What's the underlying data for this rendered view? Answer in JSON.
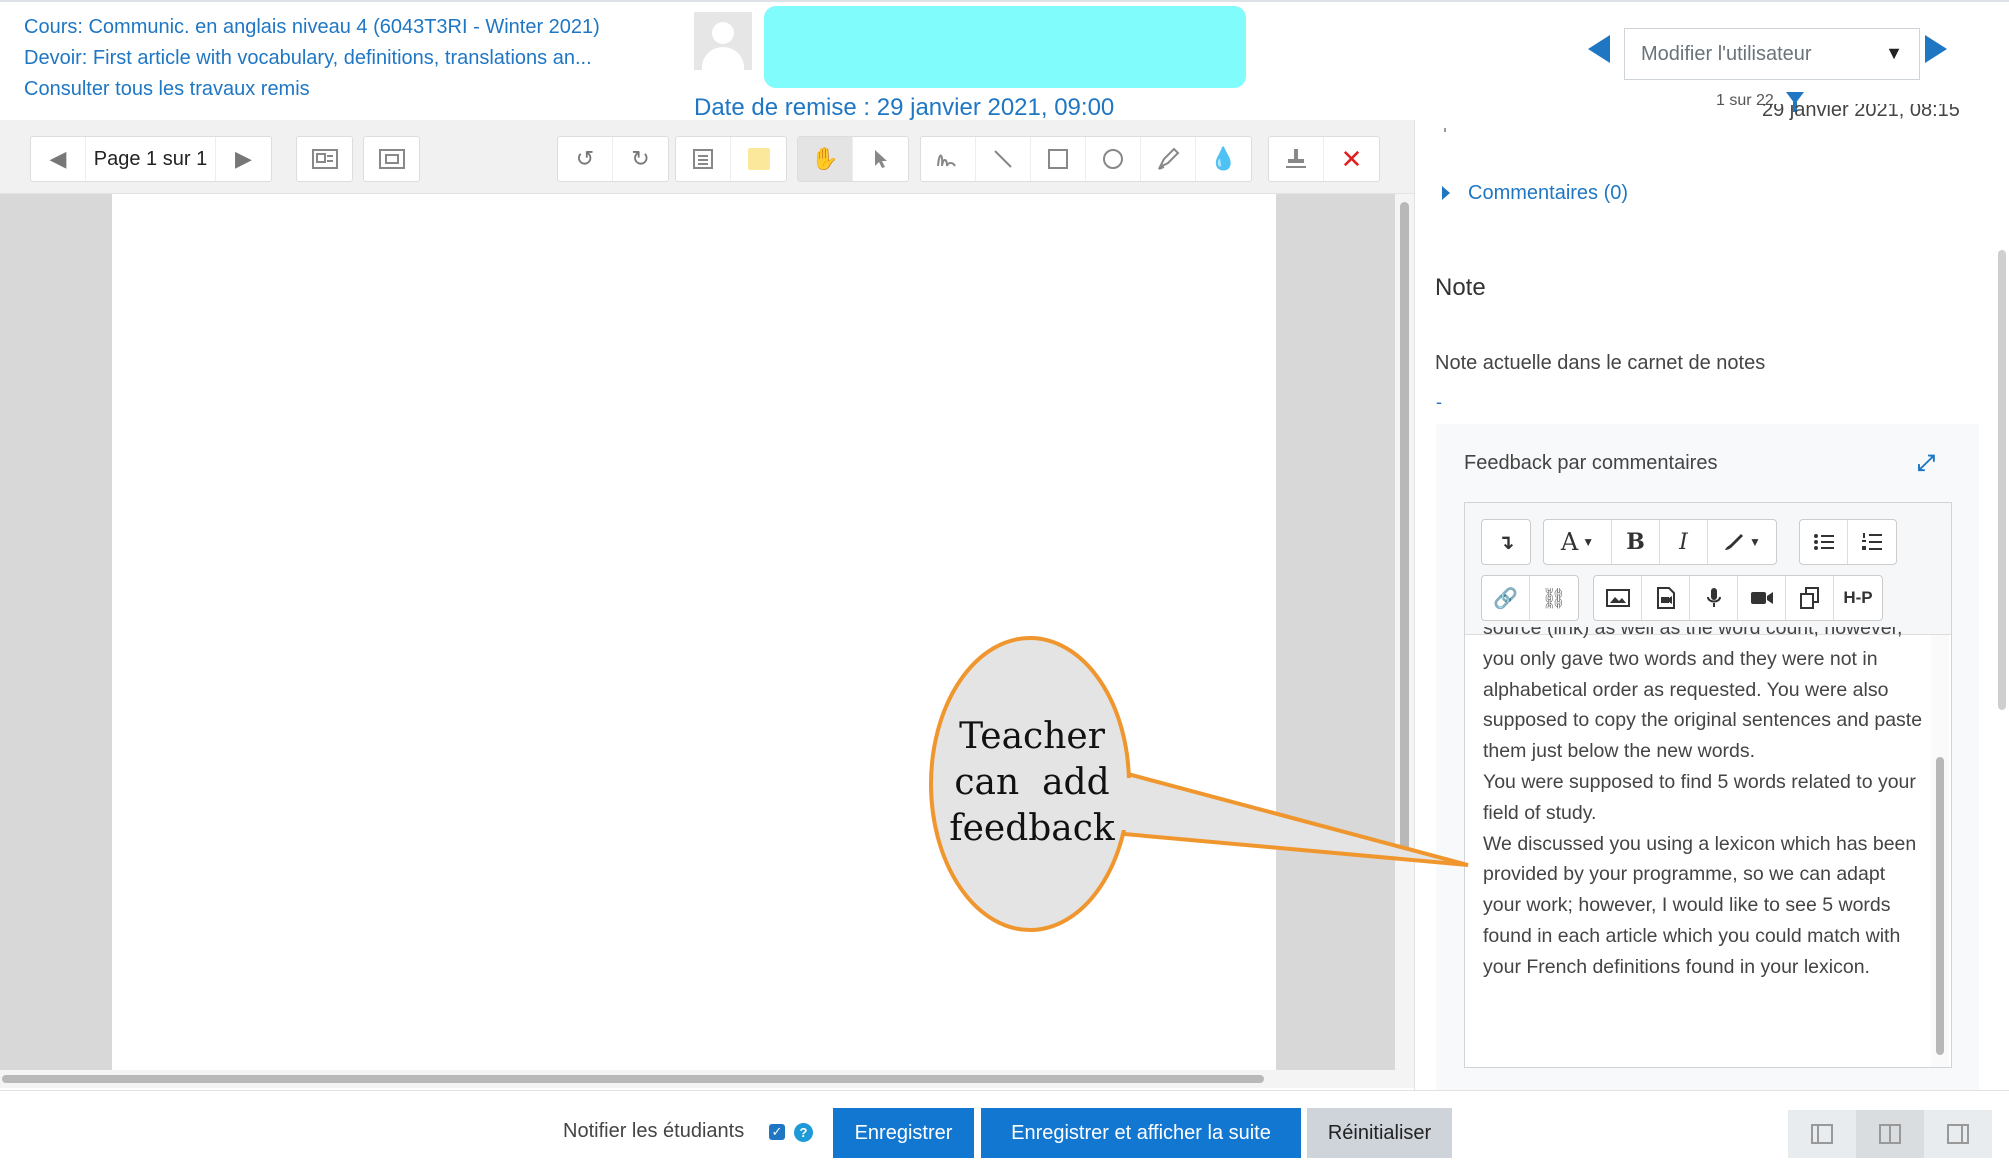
{
  "header": {
    "course_link": "Cours: Communic. en anglais niveau 4 (6043T3RI - Winter 2021)",
    "assignment_link": "Devoir: First article with vocabulary, definitions, translations an...",
    "all_submissions_link": "Consulter tous les travaux remis",
    "due_date": "Date de remise : 29 janvier 2021, 09:00",
    "user_select_value": "Modifier l'utilisateur",
    "user_count": "1 sur 22"
  },
  "toolbar": {
    "page_label": "Page 1 sur 1"
  },
  "panel": {
    "submitted_date_partial": "29 janvier 2021, 08:15",
    "comments_toggle": "Commentaires (0)",
    "grade_heading": "Note",
    "current_grade_label": "Note actuelle dans le carnet de notes",
    "current_grade_value": "-",
    "feedback_label": "Feedback par commentaires",
    "feedback_paragraphs": [
      "source (link) as well as the word count; however, you only gave two words and they were not in alphabetical order as requested. You were also supposed to copy the original sentences  and paste them just below the new words.",
      "You were supposed to find 5 words related to your field of study.",
      "We discussed you using a lexicon which has been provided by your programme, so we can adapt your work; however, I would like to see 5 words found in each article which you could match with your French definitions found in your lexicon."
    ]
  },
  "editor_toolbar": {
    "font_button": "A",
    "bold_button": "B",
    "italic_button": "I",
    "h5p_button": "H-P"
  },
  "callout": {
    "lines": [
      "Teacher",
      "can  add",
      "feedback"
    ]
  },
  "footer": {
    "notify_label": "Notifier les étudiants",
    "save_label": "Enregistrer",
    "save_next_label": "Enregistrer et afficher la suite",
    "reset_label": "Réinitialiser"
  },
  "colors": {
    "link_blue": "#1f77c4",
    "primary_button": "#1177d1",
    "redaction_cyan": "#80fcfc",
    "callout_orange": "#f0962e",
    "callout_fill": "#e4e4e4"
  }
}
